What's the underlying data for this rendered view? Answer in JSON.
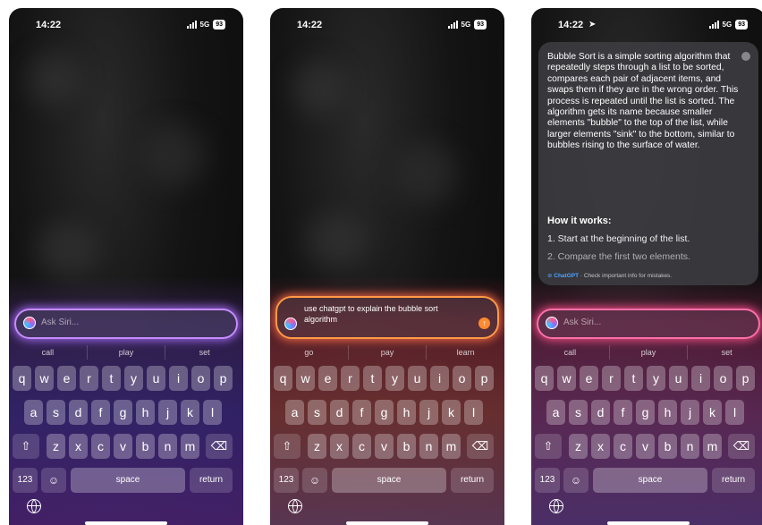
{
  "screens": [
    {
      "status": {
        "time": "14:22",
        "network": "5G",
        "battery": "93"
      },
      "siri": {
        "placeholder": "Ask Siri..."
      },
      "suggestions": [
        "call",
        "play",
        "set"
      ],
      "keyboard": {
        "row1": [
          "q",
          "w",
          "e",
          "r",
          "t",
          "y",
          "u",
          "i",
          "o",
          "p"
        ],
        "row2": [
          "a",
          "s",
          "d",
          "f",
          "g",
          "h",
          "j",
          "k",
          "l"
        ],
        "row3": [
          "z",
          "x",
          "c",
          "v",
          "b",
          "n",
          "m"
        ],
        "numbers": "123",
        "space": "space",
        "return": "return"
      },
      "accent": "#c68cff"
    },
    {
      "status": {
        "time": "14:22",
        "network": "5G",
        "battery": "93"
      },
      "siri": {
        "query": "use chatgpt to explain the bubble sort algorithm"
      },
      "suggestions": [
        "go",
        "pay",
        "learn"
      ],
      "keyboard": {
        "row1": [
          "q",
          "w",
          "e",
          "r",
          "t",
          "y",
          "u",
          "i",
          "o",
          "p"
        ],
        "row2": [
          "a",
          "s",
          "d",
          "f",
          "g",
          "h",
          "j",
          "k",
          "l"
        ],
        "row3": [
          "z",
          "x",
          "c",
          "v",
          "b",
          "n",
          "m"
        ],
        "numbers": "123",
        "space": "space",
        "return": "return"
      },
      "accent": "#ff9a45"
    },
    {
      "status": {
        "time": "14:22",
        "network": "5G",
        "battery": "93"
      },
      "answer": {
        "body": "Bubble Sort is a simple sorting algorithm that repeatedly steps through a list to be sorted, compares each pair of adjacent items, and swaps them if they are in the wrong order. This process is repeated until the list is sorted. The algorithm gets its name because smaller elements \"bubble\" to the top of the list, while larger elements \"sink\" to the bottom, similar to bubbles rising to the surface of water.",
        "heading": "How it works:",
        "steps": [
          "1. Start at the beginning of the list.",
          "2. Compare the first two elements."
        ],
        "footer_brand": "ChatGPT",
        "footer_text": " · Check important info for mistakes."
      },
      "siri": {
        "placeholder": "Ask Siri..."
      },
      "suggestions": [
        "call",
        "play",
        "set"
      ],
      "keyboard": {
        "row1": [
          "q",
          "w",
          "e",
          "r",
          "t",
          "y",
          "u",
          "i",
          "o",
          "p"
        ],
        "row2": [
          "a",
          "s",
          "d",
          "f",
          "g",
          "h",
          "j",
          "k",
          "l"
        ],
        "row3": [
          "z",
          "x",
          "c",
          "v",
          "b",
          "n",
          "m"
        ],
        "numbers": "123",
        "space": "space",
        "return": "return"
      },
      "accent": "#ff6fa8"
    }
  ]
}
